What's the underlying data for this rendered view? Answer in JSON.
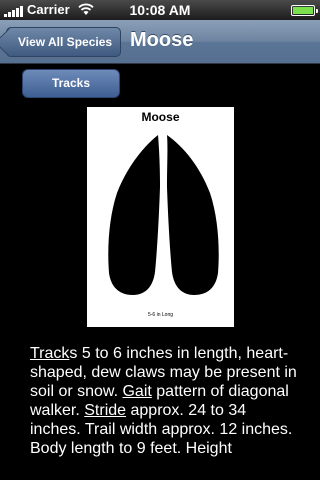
{
  "status_bar": {
    "carrier": "Carrier",
    "time": "10:08 AM",
    "battery_level": 1.0,
    "icons": [
      "signal-icon",
      "wifi-icon",
      "battery-icon"
    ]
  },
  "nav": {
    "back_label": "View All Species",
    "title": "Moose"
  },
  "tracks_button": {
    "label": "Tracks"
  },
  "track_card": {
    "title": "Moose",
    "caption": "5-6 in Long"
  },
  "description": {
    "tracks_link": "Track",
    "tracks_rest": "s 5 to 6 inches in length, heart-shaped, dew claws may be present in soil or snow. ",
    "gait_link": "Gait",
    "gait_rest": " pattern of diagonal walker. ",
    "stride_link": "Stride",
    "stride_rest": " approx. 24 to 34 inches. Trail width approx. 12 inches. Body length to 9 feet. Height"
  },
  "colors": {
    "nav_bar": "#6d84a1",
    "button": "#4f6fa3",
    "battery_fill": "#7be04b"
  }
}
